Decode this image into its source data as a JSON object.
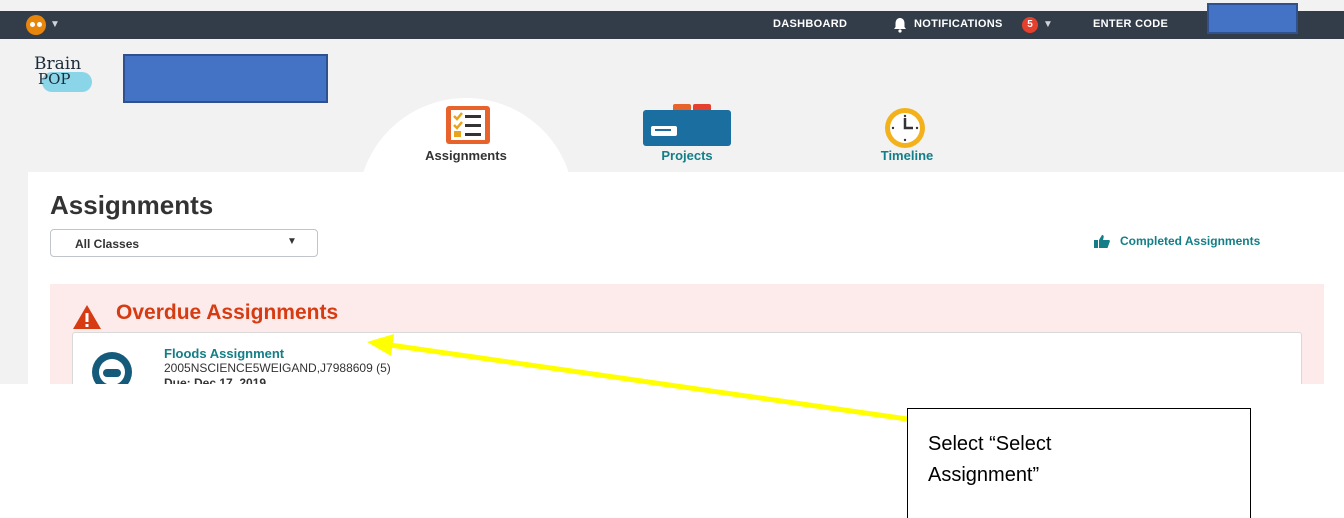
{
  "topbar": {
    "dashboard": "DASHBOARD",
    "notifications": "NOTIFICATIONS",
    "notification_count": "5",
    "enter_code": "ENTER CODE"
  },
  "logo": {
    "line1": "Brain",
    "line2": "POP"
  },
  "tabs": [
    {
      "label": "Assignments",
      "active": true
    },
    {
      "label": "Projects",
      "active": false
    },
    {
      "label": "Timeline",
      "active": false
    }
  ],
  "page": {
    "title": "Assignments",
    "class_filter": "All Classes",
    "completed_link": "Completed Assignments"
  },
  "overdue": {
    "heading": "Overdue Assignments",
    "items": [
      {
        "title": "Floods Assignment",
        "code": "2005NSCIENCE5WEIGAND,J7988609 (5)",
        "due": "Due: Dec 17, 2019"
      }
    ]
  },
  "callout": {
    "line1": "Select “Select",
    "line2": "Assignment”"
  },
  "colors": {
    "topbar": "#333d49",
    "teal": "#137e87",
    "overdue_red": "#d63b11",
    "arrow": "#ffff00"
  }
}
